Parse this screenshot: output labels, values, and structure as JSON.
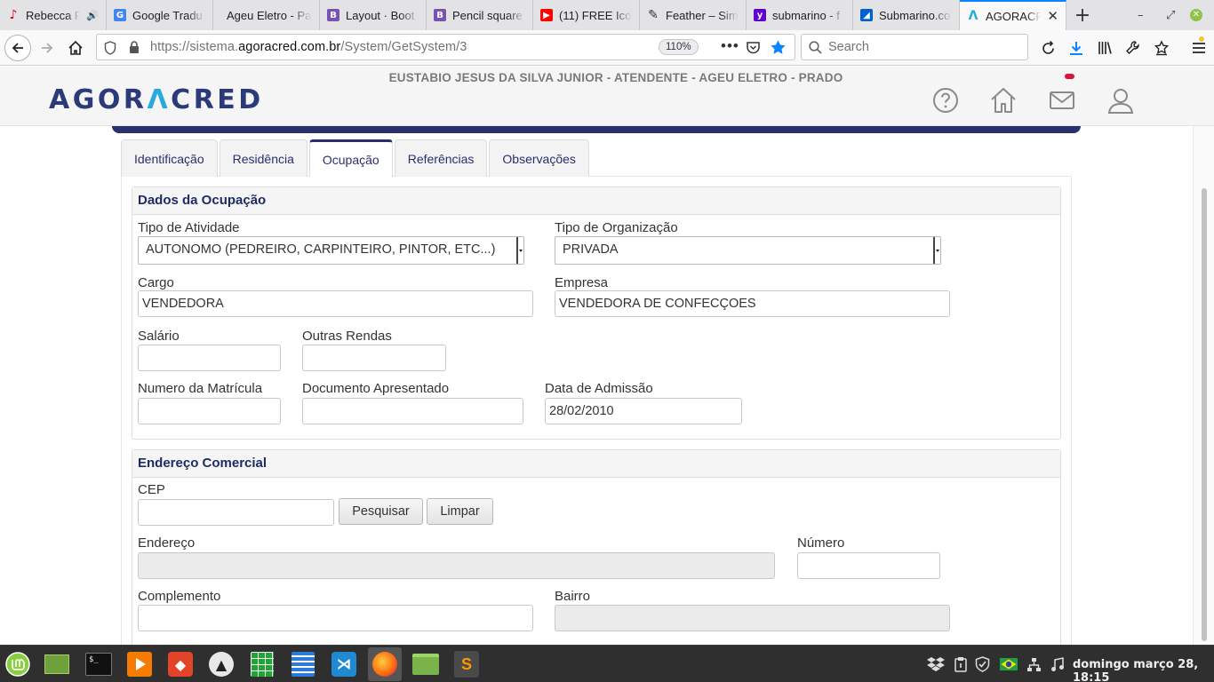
{
  "browser": {
    "tabs": [
      {
        "title": "Rebecca F",
        "icon": "music-note-icon",
        "color": "#d70022",
        "playing": true
      },
      {
        "title": "Google Tradu",
        "icon": "google-translate-icon",
        "color": "#4285f4"
      },
      {
        "title": "Ageu Eletro - Pai",
        "icon": "none"
      },
      {
        "title": "Layout · Boot",
        "icon": "bootstrap-icon",
        "color": "#7952b3"
      },
      {
        "title": "Pencil square",
        "icon": "bootstrap-icon",
        "color": "#7952b3"
      },
      {
        "title": "(11) FREE Ico",
        "icon": "youtube-icon",
        "color": "#ff0000"
      },
      {
        "title": "Feather – Sim",
        "icon": "feather-icon",
        "color": "#333333"
      },
      {
        "title": "submarino - f",
        "icon": "yahoo-icon",
        "color": "#6001d2"
      },
      {
        "title": "Submarino.co",
        "icon": "submarino-icon",
        "color": "#0060d0"
      },
      {
        "title": "AGORACRED",
        "icon": "agoracred-icon",
        "color": "#29a9e0",
        "active": true
      }
    ],
    "url_prefix": "https://sistema.",
    "url_domain": "agoracred.com.br",
    "url_path": "/System/GetSystem/3",
    "zoom": "110%",
    "search_placeholder": "Search"
  },
  "header": {
    "user_line": "EUSTABIO JESUS DA SILVA JUNIOR - ATENDENTE - AGEU ELETRO - PRADO",
    "logo_left": "AGOR",
    "logo_mark": "Λ",
    "logo_right": "CRED",
    "brand_color": "#2b3a79",
    "accent_color": "#29a9e0"
  },
  "tabs": [
    {
      "label": "Identificação",
      "active": false
    },
    {
      "label": "Residência",
      "active": false
    },
    {
      "label": "Ocupação",
      "active": true
    },
    {
      "label": "Referências",
      "active": false
    },
    {
      "label": "Observações",
      "active": false
    }
  ],
  "occupation": {
    "title": "Dados da Ocupação",
    "tipo_atividade_label": "Tipo de Atividade",
    "tipo_atividade_value": "AUTONOMO (PEDREIRO, CARPINTEIRO, PINTOR, ETC...)",
    "tipo_organizacao_label": "Tipo de Organização",
    "tipo_organizacao_value": "PRIVADA",
    "cargo_label": "Cargo",
    "cargo_value": "VENDEDORA",
    "empresa_label": "Empresa",
    "empresa_value": "VENDEDORA DE CONFECÇOES",
    "salario_label": "Salário",
    "salario_value": "",
    "outras_rendas_label": "Outras Rendas",
    "outras_rendas_value": "",
    "matricula_label": "Numero da Matrícula",
    "matricula_value": "",
    "documento_label": "Documento Apresentado",
    "documento_value": "",
    "admissao_label": "Data de Admissão",
    "admissao_value": "28/02/2010"
  },
  "address": {
    "title": "Endereço Comercial",
    "cep_label": "CEP",
    "cep_value": "",
    "search_button": "Pesquisar",
    "clear_button": "Limpar",
    "endereco_label": "Endereço",
    "numero_label": "Número",
    "complemento_label": "Complemento",
    "bairro_label": "Bairro"
  },
  "taskbar": {
    "clock": "domingo março 28, 18:15"
  }
}
